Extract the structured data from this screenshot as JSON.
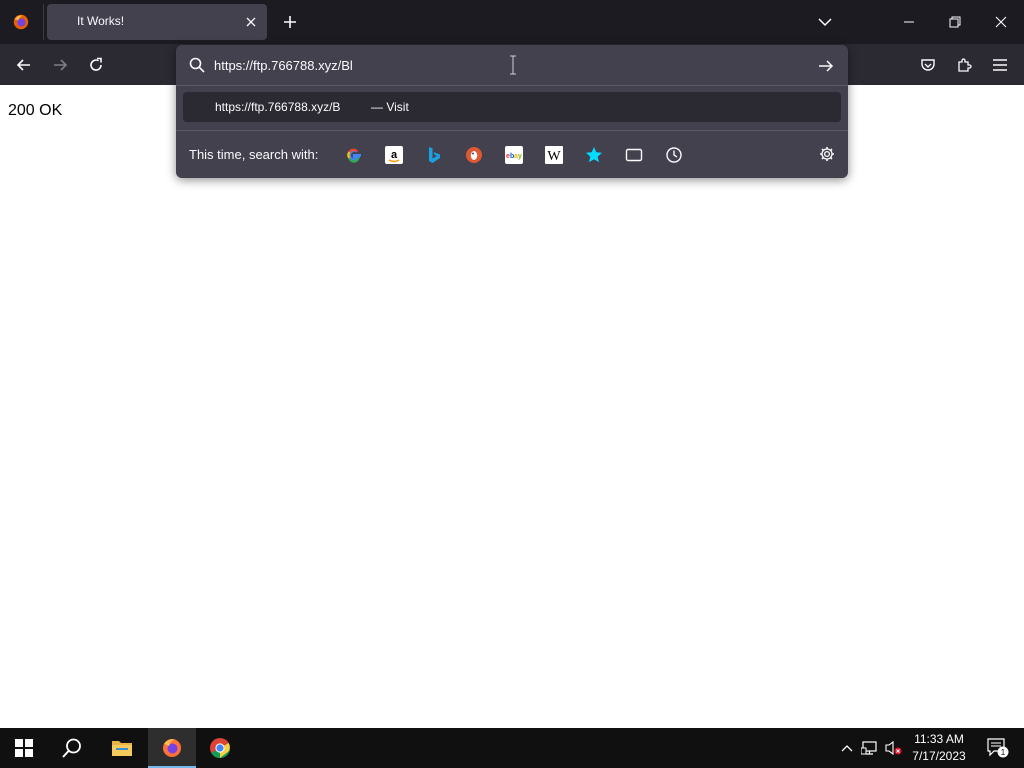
{
  "browser": {
    "tab": {
      "title": "It Works!"
    },
    "url_bar": {
      "value": "https://ftp.766788.xyz/Bl"
    },
    "suggestion": {
      "url": "https://ftp.766788.xyz/B",
      "action": "— Visit"
    },
    "search_engines": {
      "label": "This time, search with:",
      "engines": [
        "google-icon",
        "amazon-icon",
        "bing-icon",
        "duckduckgo-icon",
        "ebay-icon",
        "wikipedia-icon",
        "bookmarks-icon",
        "tabs-icon",
        "history-icon"
      ]
    }
  },
  "page": {
    "text": "200 OK"
  },
  "taskbar": {
    "clock": {
      "time": "11:33 AM",
      "date": "7/17/2023"
    },
    "notification_count": "1"
  },
  "colors": {
    "tabstrip_bg": "#1c1b22",
    "toolbar_bg": "#2b2a33",
    "popup_bg": "#42414d",
    "taskbar_bg": "#101010",
    "accent_active": "#76b9ed"
  }
}
